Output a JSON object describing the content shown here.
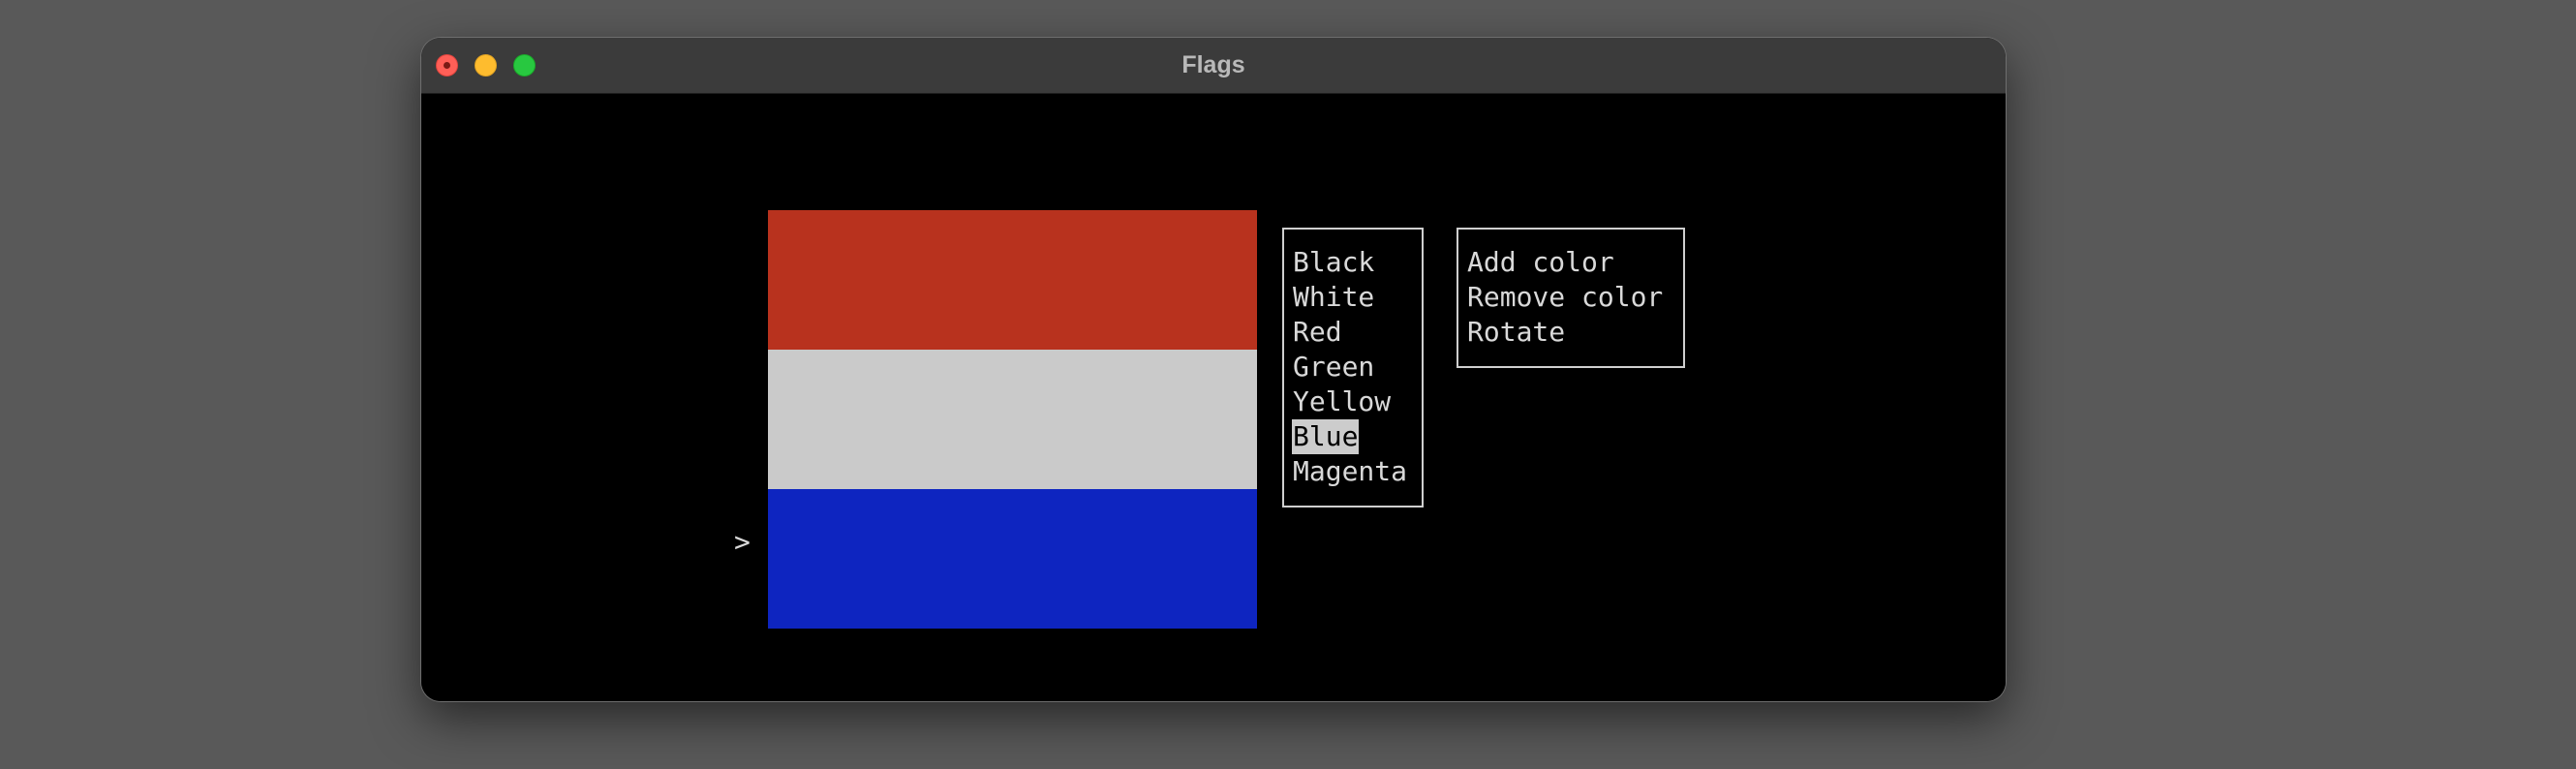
{
  "window": {
    "title": "Flags"
  },
  "prompt": {
    "symbol": ">"
  },
  "flag": {
    "stripes": [
      {
        "color": "#b8321e"
      },
      {
        "color": "#cacaca"
      },
      {
        "color": "#0e25c0"
      }
    ]
  },
  "colors_menu": {
    "items": [
      {
        "label": "Black"
      },
      {
        "label": "White"
      },
      {
        "label": "Red"
      },
      {
        "label": "Green"
      },
      {
        "label": "Yellow"
      },
      {
        "label": "Blue",
        "selected": true
      },
      {
        "label": "Magenta"
      }
    ]
  },
  "actions_menu": {
    "items": [
      {
        "label": "Add color"
      },
      {
        "label": "Remove color"
      },
      {
        "label": "Rotate"
      }
    ]
  }
}
